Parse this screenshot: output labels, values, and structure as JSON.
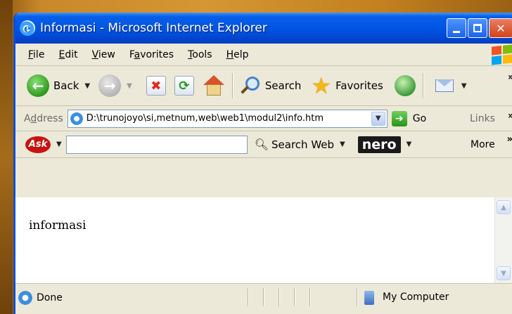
{
  "window": {
    "title": "Informasi - Microsoft Internet Explorer"
  },
  "menubar": {
    "items": [
      {
        "accel": "F",
        "rest": "ile"
      },
      {
        "accel": "E",
        "rest": "dit"
      },
      {
        "accel": "V",
        "rest": "iew"
      },
      {
        "pre": "F",
        "accel": "a",
        "rest": "vorites"
      },
      {
        "accel": "T",
        "rest": "ools"
      },
      {
        "accel": "H",
        "rest": "elp"
      }
    ]
  },
  "toolbar": {
    "back_label": "Back",
    "search_label": "Search",
    "favorites_label": "Favorites",
    "overflow": "»"
  },
  "address": {
    "label_accel": "d",
    "label_pre": "A",
    "label_rest": "dress",
    "url": "D:\\trunojoyo\\si,metnum,web\\web1\\modul2\\info.htm",
    "go_label": "Go",
    "links_label": "Links",
    "overflow": "»"
  },
  "askbar": {
    "logo": "Ask",
    "search_web_label": "Search Web",
    "nero_logo": "nero",
    "more_label": "More",
    "more_chevron": "»"
  },
  "content": {
    "text": "informasi"
  },
  "status": {
    "text": "Done",
    "zone": "My Computer"
  }
}
